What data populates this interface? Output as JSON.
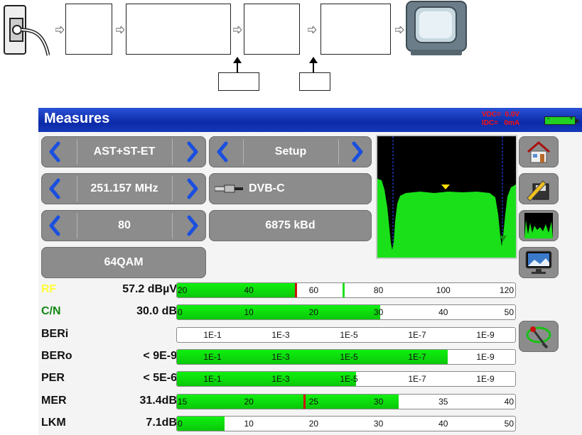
{
  "panel": {
    "title": "Measures",
    "vdc": "VDC=  0.0V",
    "idc": "IDC=   0mA",
    "battery_minus": "-",
    "battery_plus": "+",
    "controls": {
      "satellite": "AST+ST-ET",
      "frequency": "251.157 MHz",
      "channel": "80",
      "modulation": "64QAM",
      "setup": "Setup",
      "standard": "DVB-C",
      "symbol_rate": "6875 kBd"
    },
    "measures": [
      {
        "label": "RF",
        "label_color": "#ffff33",
        "value": "57.2 dBµV",
        "fill": 0.35,
        "marks": [
          {
            "pos": 0.348,
            "color": "#d01010"
          },
          {
            "pos": 0.49,
            "color": "#20e020"
          }
        ],
        "ticks": [
          "20",
          "40",
          "60",
          "80",
          "100",
          "120"
        ]
      },
      {
        "label": "C/N",
        "label_color": "#118811",
        "value": "30.0 dB",
        "fill": 0.6,
        "marks": [],
        "ticks": [
          "0",
          "10",
          "20",
          "30",
          "40",
          "50"
        ]
      },
      {
        "label": "BERi",
        "label_color": "#111111",
        "value": "",
        "fill": 0.0,
        "marks": [],
        "ticks": [
          "1E-1",
          "1E-3",
          "1E-5",
          "1E-7",
          "1E-9"
        ]
      },
      {
        "label": "BERo",
        "label_color": "#111111",
        "value": "< 9E-9",
        "fill": 0.8,
        "marks": [],
        "ticks": [
          "1E-1",
          "1E-3",
          "1E-5",
          "1E-7",
          "1E-9"
        ]
      },
      {
        "label": "PER",
        "label_color": "#111111",
        "value": "< 5E-6",
        "fill": 0.53,
        "marks": [],
        "ticks": [
          "1E-1",
          "1E-3",
          "1E-5",
          "1E-7",
          "1E-9"
        ]
      },
      {
        "label": "MER",
        "label_color": "#111111",
        "value": "31.4dB",
        "fill": 0.655,
        "marks": [
          {
            "pos": 0.374,
            "color": "#d01010"
          }
        ],
        "ticks": [
          "15",
          "20",
          "25",
          "30",
          "35",
          "40"
        ]
      },
      {
        "label": "LKM",
        "label_color": "#111111",
        "value": "7.1dB",
        "fill": 0.14,
        "marks": [],
        "ticks": [
          "0",
          "10",
          "20",
          "30",
          "40",
          "50"
        ]
      }
    ],
    "side_icons": [
      "home-icon",
      "edit-save-icon",
      "spectrum-icon",
      "tv-icon",
      "antenna-pointing-icon"
    ]
  }
}
